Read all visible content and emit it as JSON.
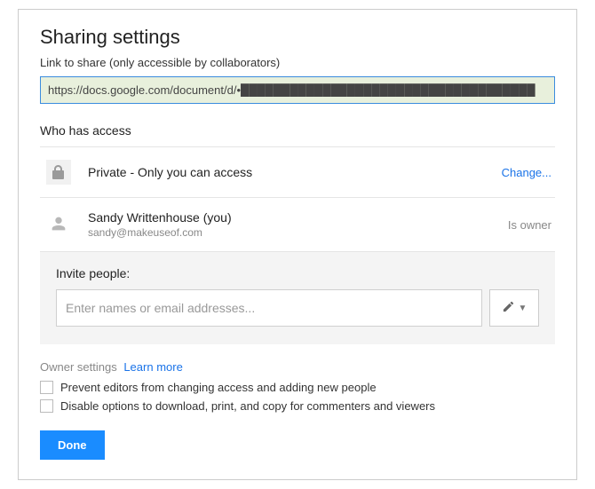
{
  "dialog": {
    "title": "Sharing settings",
    "link_label": "Link to share (only accessible by collaborators)",
    "link_value": "https://docs.google.com/document/d/•████████████████████████████████████"
  },
  "access": {
    "heading": "Who has access",
    "privacy_text": "Private - Only you can access",
    "change_label": "Change...",
    "user_name": "Sandy Writtenhouse (you)",
    "user_email": "sandy@makeuseof.com",
    "role_label": "Is owner"
  },
  "invite": {
    "label": "Invite people:",
    "placeholder": "Enter names or email addresses..."
  },
  "owner_settings": {
    "label": "Owner settings",
    "learn_more": "Learn more",
    "opt1": "Prevent editors from changing access and adding new people",
    "opt2": "Disable options to download, print, and copy for commenters and viewers"
  },
  "buttons": {
    "done": "Done"
  },
  "colors": {
    "accent": "#1a8cff",
    "link": "#1a73e8"
  }
}
